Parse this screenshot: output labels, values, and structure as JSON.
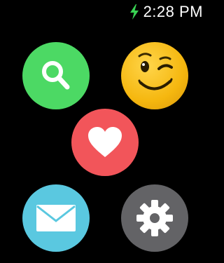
{
  "status_bar": {
    "time": "2:28 PM",
    "charging_icon": "lightning-bolt-icon"
  },
  "colors": {
    "background": "#000000",
    "charging": "#39d353",
    "search_app": "#4cd964",
    "emoji_app": "#f5b70f",
    "heart_app": "#f2555a",
    "mail_app": "#5ac8e0",
    "settings_app": "#636366"
  },
  "apps": [
    {
      "name": "search",
      "icon": "magnifying-glass-icon"
    },
    {
      "name": "emoji",
      "icon": "winking-face-icon"
    },
    {
      "name": "heart",
      "icon": "heart-icon"
    },
    {
      "name": "mail",
      "icon": "envelope-icon"
    },
    {
      "name": "settings",
      "icon": "gear-icon"
    }
  ]
}
